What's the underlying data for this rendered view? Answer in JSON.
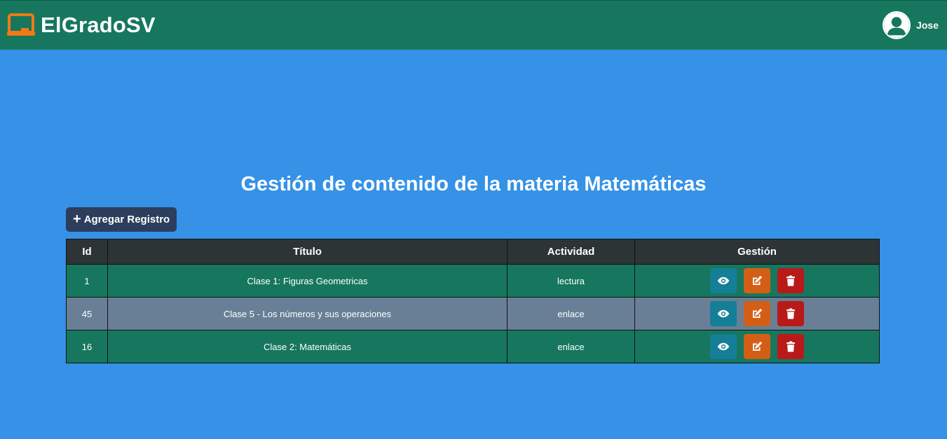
{
  "header": {
    "brand": "ElGradoSV",
    "user_name": "Jose",
    "brand_icon": "chalkboard-icon",
    "user_icon": "user-avatar-icon"
  },
  "main": {
    "title": "Gestión de contenido de la materia Matemáticas",
    "add_button_label": "Agregar Registro",
    "add_button_icon": "plus-icon"
  },
  "table": {
    "headers": [
      "Id",
      "Título",
      "Actividad",
      "Gestión"
    ],
    "rows": [
      {
        "id": "1",
        "title": "Clase 1: Figuras Geometricas",
        "activity": "lectura"
      },
      {
        "id": "45",
        "title": "Clase 5 - Los números y sus operaciones",
        "activity": "enlace"
      },
      {
        "id": "16",
        "title": "Clase 2: Matemáticas",
        "activity": "enlace"
      }
    ],
    "action_icons": [
      "eye-icon",
      "edit-icon",
      "trash-icon"
    ]
  },
  "colors": {
    "navbar": "#16775e",
    "background": "#3592e6",
    "header_row": "#2d3435",
    "row_alt": "#697f95",
    "view": "#147f96",
    "edit": "#d35f16",
    "delete": "#b81a1a",
    "brand_icon": "#f07a16"
  }
}
